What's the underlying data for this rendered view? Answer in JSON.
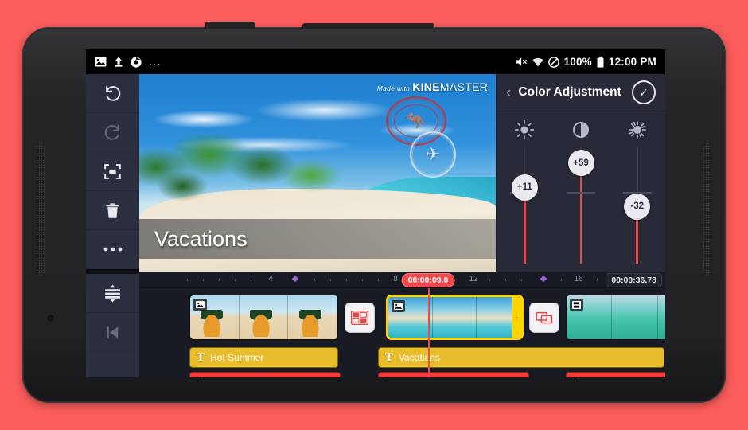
{
  "background_color": "#fb5c5c",
  "status_bar": {
    "left_icons": [
      "image-icon",
      "upload-icon",
      "chrome-icon",
      "more-icon"
    ],
    "more": "...",
    "battery_percent": "100%",
    "time": "12:00 PM",
    "right_icons": [
      "mute-icon",
      "wifi-icon",
      "do-not-disturb-icon",
      "battery-icon"
    ]
  },
  "tool_rail": {
    "items": [
      {
        "name": "undo-button",
        "glyph": "undo",
        "dim": false
      },
      {
        "name": "redo-button",
        "glyph": "redo",
        "dim": true
      },
      {
        "name": "fit-to-screen-button",
        "glyph": "expand",
        "dim": false
      },
      {
        "name": "delete-button",
        "glyph": "trash",
        "dim": false
      },
      {
        "name": "more-options-button",
        "glyph": "dots",
        "dim": false
      },
      {
        "name": "expand-tracks-button",
        "glyph": "tracks",
        "dim": false
      },
      {
        "name": "jump-to-start-button",
        "glyph": "skipstart",
        "dim": true
      }
    ]
  },
  "preview": {
    "caption": "Vacations",
    "watermark_prefix": "Made with",
    "watermark_brand_bold": "KINE",
    "watermark_brand_light": "MASTER",
    "stamps": [
      "australia-kangaroo-stamp",
      "airplane-stamp"
    ]
  },
  "panel": {
    "back_label": "‹",
    "title": "Color Adjustment",
    "confirm_label": "✓",
    "sliders": [
      {
        "name": "brightness-slider",
        "icon": "brightness-icon",
        "value": "+11",
        "pos_pct": 50
      },
      {
        "name": "contrast-slider",
        "icon": "contrast-icon",
        "value": "+59",
        "pos_pct": 35
      },
      {
        "name": "saturation-slider",
        "icon": "saturation-icon",
        "value": "-32",
        "pos_pct": 62
      }
    ]
  },
  "timeline": {
    "current_time": "00:00:09.0",
    "total_time": "00:00:36.78",
    "tick_labels": [
      "4",
      "8",
      "12",
      "16"
    ],
    "markers": 2,
    "clips": [
      {
        "name": "video-clip-hot-summer",
        "thumb_class": "th-pine",
        "badge": "image-icon",
        "selected": false
      },
      {
        "name": "video-clip-vacations",
        "thumb_class": "th-beach",
        "badge": "image-icon",
        "selected": true
      },
      {
        "name": "video-clip-reef",
        "thumb_class": "th-green",
        "badge": "video-icon",
        "selected": false
      }
    ],
    "transitions": [
      {
        "name": "transition-checkerboard",
        "icon": "checkerboard-icon"
      },
      {
        "name": "transition-crossfade",
        "icon": "overlap-icon"
      }
    ],
    "text_clips": [
      {
        "name": "text-clip-hot-summer",
        "label": "Hot Summer"
      },
      {
        "name": "text-clip-vacations",
        "label": "Vacations"
      }
    ],
    "audio_clips": [
      {
        "name": "audio-clip-1",
        "label": ""
      },
      {
        "name": "audio-clip-2",
        "label": ""
      },
      {
        "name": "audio-clip-3",
        "label": ""
      }
    ]
  }
}
